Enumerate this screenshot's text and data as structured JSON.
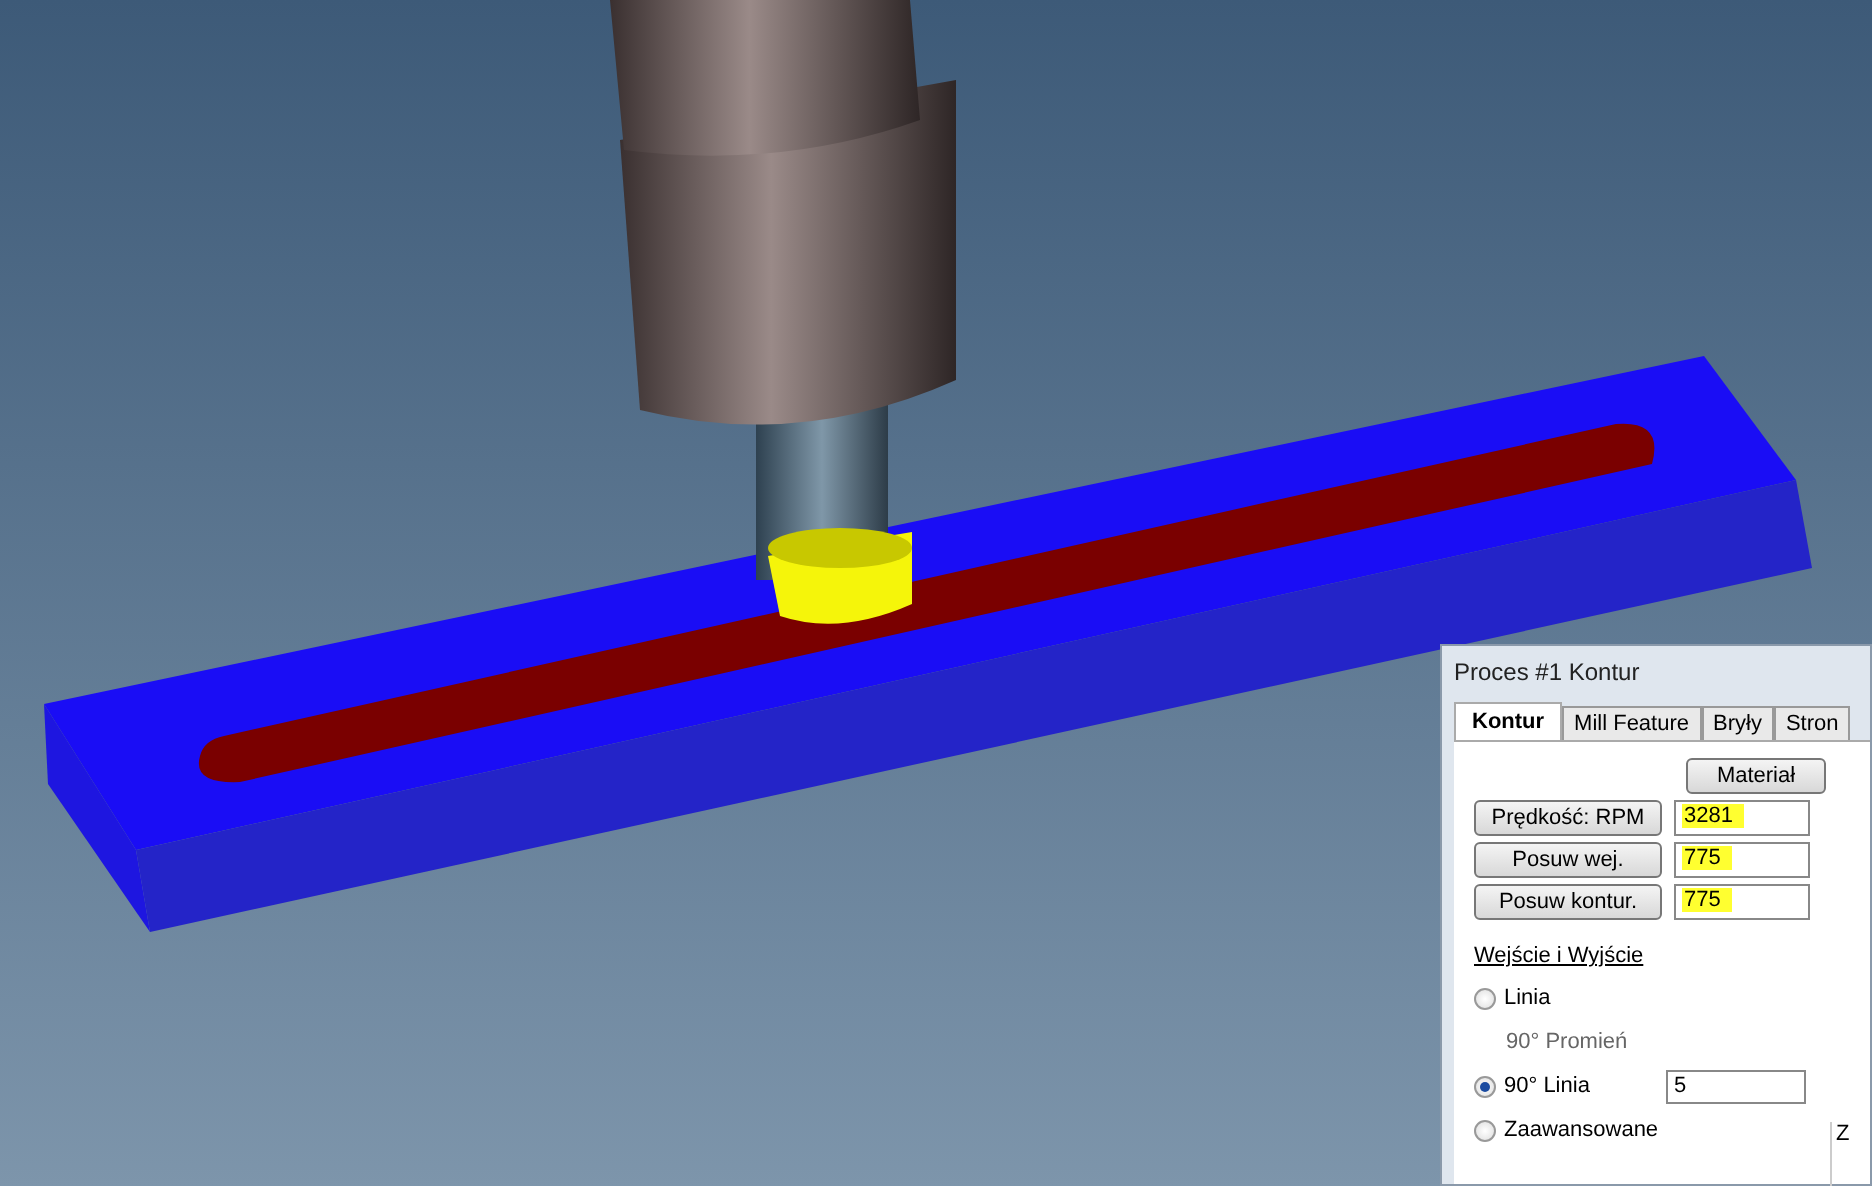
{
  "dialog": {
    "title": "Proces #1 Kontur",
    "tabs": [
      {
        "label": "Kontur",
        "selected": true
      },
      {
        "label": "Mill Feature",
        "selected": false
      },
      {
        "label": "Bryły",
        "selected": false
      },
      {
        "label": "Stron",
        "selected": false
      }
    ],
    "material_button": "Materiał",
    "fields": [
      {
        "button": "Prędkość: RPM",
        "value": "3281",
        "highlighted": true
      },
      {
        "button": "Posuw wej.",
        "value": "775",
        "highlighted": true
      },
      {
        "button": "Posuw kontur.",
        "value": "775",
        "highlighted": true
      }
    ],
    "section_title": "Wejście i Wyjście",
    "options": [
      {
        "kind": "radio",
        "label": "Linia",
        "selected": false
      },
      {
        "kind": "note",
        "label": "90° Promień"
      },
      {
        "kind": "radio",
        "label": "90° Linia",
        "selected": true,
        "value": "5"
      },
      {
        "kind": "radio",
        "label": "Zaawansowane",
        "selected": false
      }
    ],
    "group_label": "Z"
  }
}
